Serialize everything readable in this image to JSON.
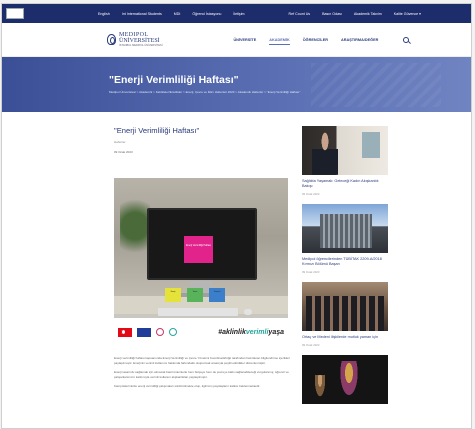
{
  "topbar": {
    "logo_chip": "",
    "left_links": [
      "English",
      "Int International Students",
      "MDI",
      "Öğrenci İstasyonu",
      "İletişim"
    ],
    "right_links": [
      "Ref Count Us",
      "Basın Odası",
      "Akademik Takvim",
      "Kalite Güvence ▾"
    ]
  },
  "header": {
    "brand_name": "MEDIPOL",
    "brand_sub": "ÜNİVERSİTESİ",
    "brand_tag": "İSTANBUL MEDIPOL ÜNİVERSİTESİ",
    "nav": [
      "ÜNİVERSİTE",
      "AKADEMİK",
      "ÖĞRENCİLER",
      "ARAŞTIRMA/DEĞER",
      ""
    ]
  },
  "banner": {
    "title": "\"Enerji Verimliliği Haftası\"",
    "breadcrumb": "Medipol Üniversitesi > Akademik > Fakülteler/Enstitüler > Enerji, Çevre ve İklim Haberleri 2023 > Akademik Haberler > \"Enerji Verimliliği Haftası\""
  },
  "article": {
    "title": "\"Enerji Verimliliği Haftası\"",
    "meta": "Haberler",
    "date": "09 Ocak 2023",
    "image": {
      "note_text": "Enerji Verimliliği Haftası",
      "small_notes": [
        "Enerji",
        "Verim",
        "Tasarruf"
      ],
      "hashtag_prefix": "#aklinlik",
      "hashtag_accent": "verimli",
      "hashtag_suffix": "yaşa"
    },
    "paragraphs": [
      "Enerji verimliliği haftası kapsamında Enerji Verimliliği ve Çevre Yönetimi Koordinatörlüğü tarafından hazırlanan bilgilendirme içerikleri paylaşılmıştır. Enerjinin verimli kullanımı hakkında farkındalık oluşturmak amacıyla çeşitli etkinlikler düzenlenmiştir.",
      "Enerji tasarrufu sağlamak için alınacak basit önlemlerle hem bütçeye hem de çevreye katkı sağlanabileceği vurgulanmış; öğrenci ve çalışanlarımızın katılımıyla verimli kullanım alışkanlıkları paylaşılmıştır.",
      "Kampüslerimizde enerji verimliliği çalışmaları sürdürülmekte olup, ilgili tüm paydaşların katkısı beklenmektedir."
    ]
  },
  "sidebar": {
    "cards": [
      {
        "title": "Sağlıkta Yaşamak: Geleceği Kadın Akışkanlık Bakışı",
        "date": "09 Ocak 2023"
      },
      {
        "title": "Medipol öğrencilerinden TÜBİTAK 2209-A/2018 Kırmızı Bölümü Başarı",
        "date": "09 Ocak 2023"
      },
      {
        "title": "Ortaç ve Medeni ilişkilerde mutluk yaman için",
        "date": "09 Ocak 2023"
      },
      {
        "title": "",
        "date": ""
      }
    ]
  }
}
